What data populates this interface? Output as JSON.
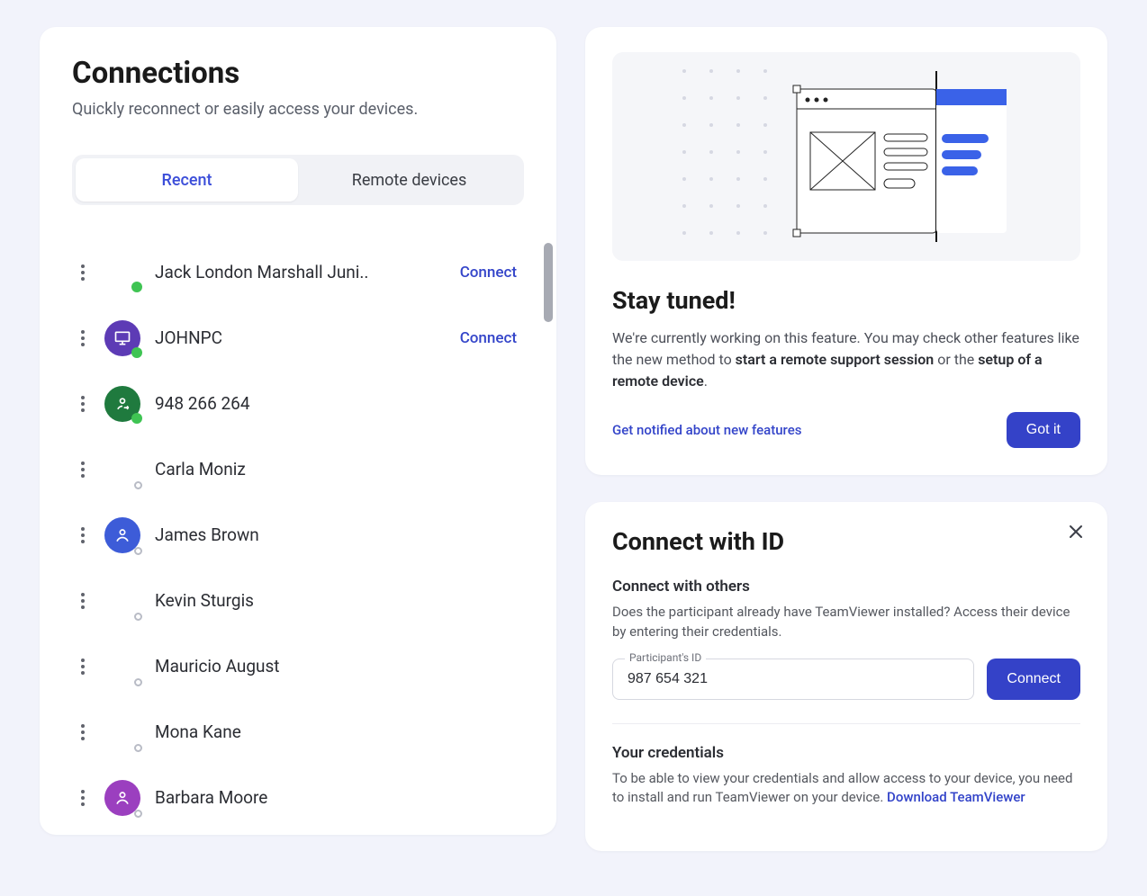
{
  "connections": {
    "title": "Connections",
    "subtitle": "Quickly reconnect or easily access your devices.",
    "tabs": {
      "recent": "Recent",
      "remote": "Remote devices"
    },
    "connect_label": "Connect",
    "items": [
      {
        "name": "Jack London Marshall Juni..",
        "icon": "none",
        "color": "",
        "status": "online",
        "connect": true
      },
      {
        "name": "JOHNPC",
        "icon": "monitor",
        "color": "#5d3bb5",
        "status": "online",
        "connect": true
      },
      {
        "name": "948 266 264",
        "icon": "swap",
        "color": "#1f7a3e",
        "status": "online",
        "connect": false
      },
      {
        "name": "Carla Moniz",
        "icon": "none",
        "color": "",
        "status": "offline",
        "connect": false
      },
      {
        "name": "James Brown",
        "icon": "person",
        "color": "#3d5cd8",
        "status": "offline",
        "connect": false
      },
      {
        "name": "Kevin Sturgis",
        "icon": "none",
        "color": "",
        "status": "offline",
        "connect": false
      },
      {
        "name": "Mauricio August",
        "icon": "none",
        "color": "",
        "status": "offline",
        "connect": false
      },
      {
        "name": "Mona Kane",
        "icon": "none",
        "color": "",
        "status": "offline",
        "connect": false
      },
      {
        "name": "Barbara Moore",
        "icon": "person",
        "color": "#9b3fbf",
        "status": "offline",
        "connect": false
      }
    ]
  },
  "feature": {
    "title": "Stay tuned!",
    "body_pre": "We're currently working on this feature. You may check other features like the new method to ",
    "body_b1": "start a remote support session",
    "body_mid": " or the ",
    "body_b2": "setup of a remote device",
    "body_post": ".",
    "link": "Get notified about new features",
    "cta": "Got it"
  },
  "connect_id": {
    "title": "Connect with ID",
    "sec1_title": "Connect with others",
    "sec1_desc": "Does the participant already have TeamViewer installed? Access their device by entering their credentials.",
    "field_label": "Participant's ID",
    "field_value": "987 654 321",
    "connect_btn": "Connect",
    "sec2_title": "Your credentials",
    "sec2_desc": "To be able to view your credentials and allow access to your device, you need to install and run TeamViewer on your device.  ",
    "download": "Download TeamViewer"
  }
}
